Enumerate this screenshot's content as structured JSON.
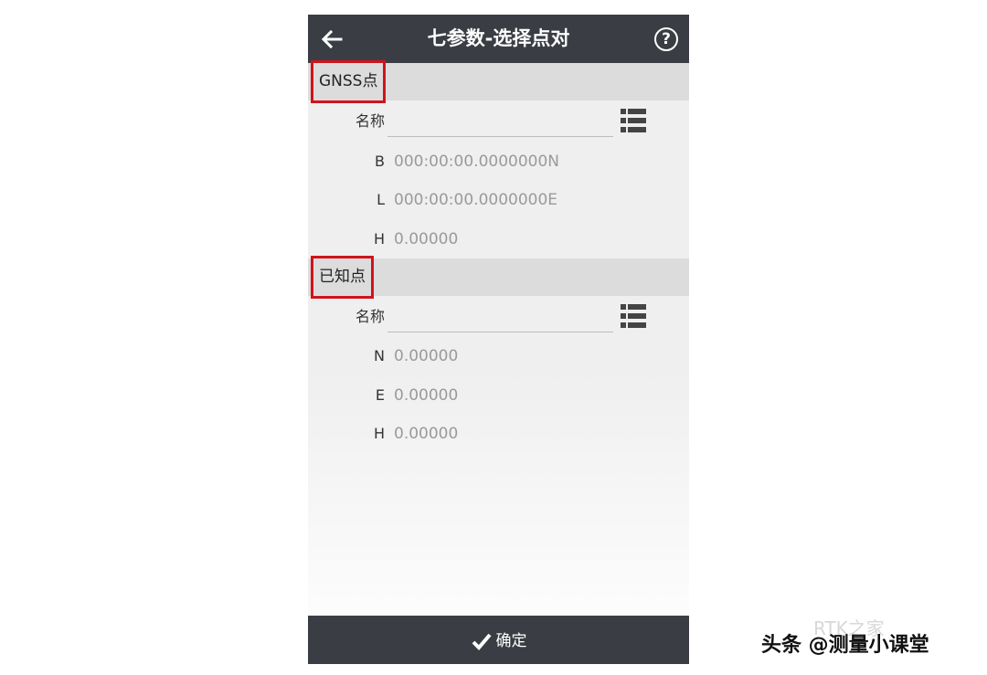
{
  "header": {
    "title": "七参数-选择点对"
  },
  "icons": {
    "back": "back-arrow-icon",
    "help": "question-mark-icon",
    "list": "list-icon",
    "confirm": "check-icon"
  },
  "gnss": {
    "title": "GNSS点",
    "name_label": "名称",
    "name_value": "",
    "fields": [
      {
        "label": "B",
        "value": "000:00:00.0000000N"
      },
      {
        "label": "L",
        "value": "000:00:00.0000000E"
      },
      {
        "label": "H",
        "value": "0.00000"
      }
    ]
  },
  "known": {
    "title": "已知点",
    "name_label": "名称",
    "name_value": "",
    "fields": [
      {
        "label": "N",
        "value": "0.00000"
      },
      {
        "label": "E",
        "value": "0.00000"
      },
      {
        "label": "H",
        "value": "0.00000"
      }
    ]
  },
  "footer": {
    "confirm_label": "确定"
  },
  "watermark": {
    "text": "头条 @测量小课堂",
    "ghost_text": "RTK之家"
  },
  "colors": {
    "bar": "#3a3e44",
    "highlight": "#d0131b",
    "section": "#dcdcdc",
    "value": "#9a9a9a"
  }
}
